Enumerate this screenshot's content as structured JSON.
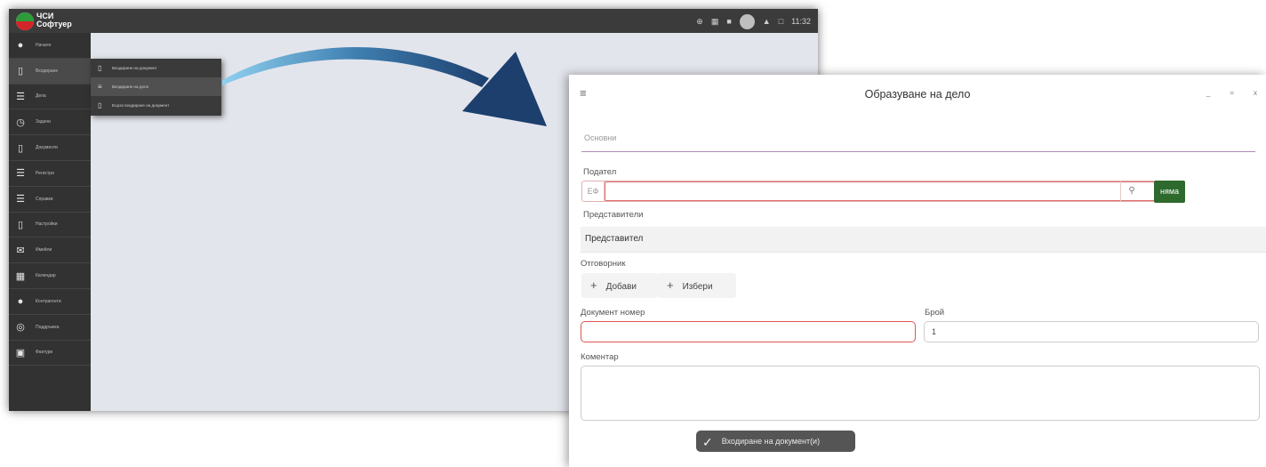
{
  "app": {
    "logo_line1": "ЧСИ",
    "logo_line2": "Софтуер",
    "clock": "11:32",
    "sidebar": [
      {
        "label": "Начало",
        "icon": "person-icon"
      },
      {
        "label": "Входиране",
        "icon": "document-icon"
      },
      {
        "label": "Дела",
        "icon": "list-icon"
      },
      {
        "label": "Задачи",
        "icon": "clock-icon"
      },
      {
        "label": "Документи",
        "icon": "document-icon"
      },
      {
        "label": "Регистри",
        "icon": "list-icon"
      },
      {
        "label": "Справки",
        "icon": "list-icon"
      },
      {
        "label": "Настройки",
        "icon": "document-icon"
      },
      {
        "label": "Имейли",
        "icon": "mail-icon"
      },
      {
        "label": "Календар",
        "icon": "calendar-icon"
      },
      {
        "label": "Контрагенти",
        "icon": "person-icon"
      },
      {
        "label": "Поддръжка",
        "icon": "support-icon"
      },
      {
        "label": "Фактури",
        "icon": "invoice-icon"
      }
    ],
    "flyout": [
      {
        "label": "Входиране на документ"
      },
      {
        "label": "Входиране на дело"
      },
      {
        "label": "Бързо входиране на документ"
      }
    ]
  },
  "dialog": {
    "title": "Образуване на дело",
    "tab": "Основни",
    "sender_label": "Подател",
    "sender_prefix": "ЕФ",
    "sender_value": "",
    "none_button": "няма",
    "representatives_label": "Представители",
    "representative_header": "Представител",
    "respondent_label": "Отговорник",
    "add_button": "Добави",
    "choose_button": "Избери",
    "doc_number_label": "Документ номер",
    "doc_number_value": "",
    "count_label": "Брой",
    "count_value": "1",
    "comment_label": "Коментар",
    "submit_button": "Входиране на документ(и)"
  },
  "colors": {
    "sidebar_bg": "#323232",
    "accent_green": "#2e6a2e",
    "error_red": "#e05555",
    "tab_underline": "#b08ab8"
  }
}
